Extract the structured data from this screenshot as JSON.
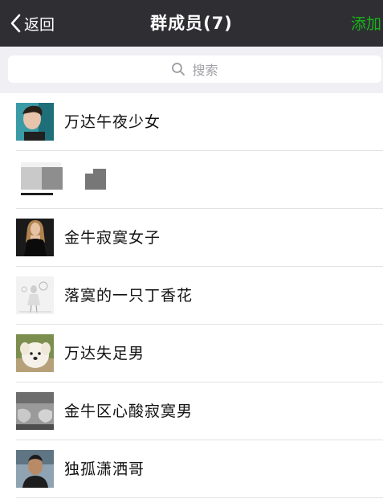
{
  "nav": {
    "back_label": "返回",
    "title": "群成员(7)",
    "add_label": "添加",
    "bar_color": "#2e2e33",
    "add_color": "#18b419"
  },
  "search": {
    "placeholder": "搜索"
  },
  "members": [
    {
      "name": "万达午夜少女",
      "avatar": "avatar-young-man-photo"
    },
    {
      "name": "",
      "avatar": "pixelated-mosaic"
    },
    {
      "name": "金牛寂寞女子",
      "avatar": "avatar-woman-black-dress-photo"
    },
    {
      "name": "落寞的一只丁香花",
      "avatar": "avatar-sketch-girl-photo"
    },
    {
      "name": "万达失足男",
      "avatar": "avatar-white-dog-photo"
    },
    {
      "name": "金牛区心酸寂寞男",
      "avatar": "avatar-feet-photo"
    },
    {
      "name": "独孤潇洒哥",
      "avatar": "avatar-man-portrait-photo"
    }
  ]
}
